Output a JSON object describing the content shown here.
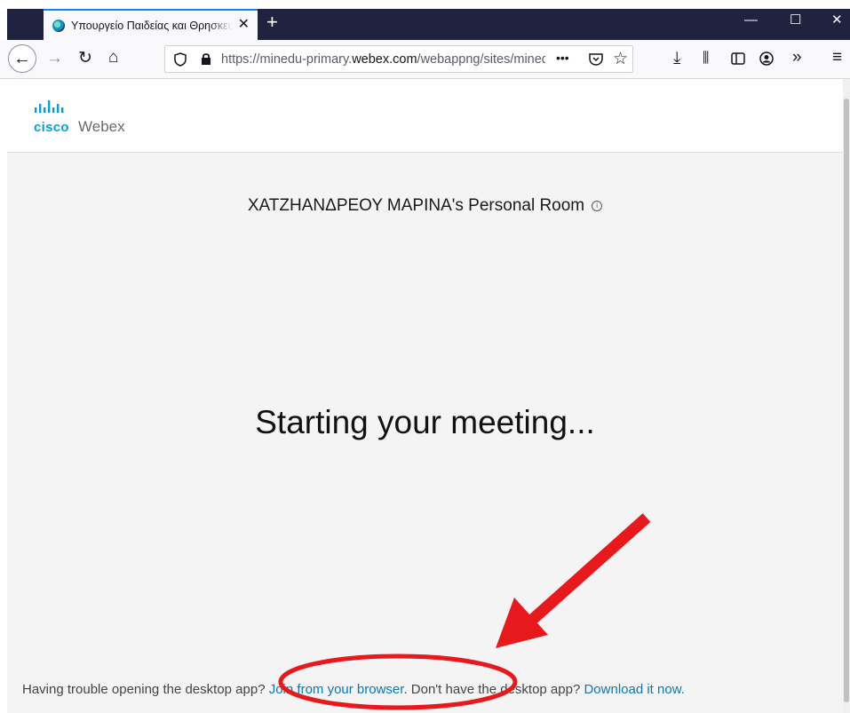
{
  "browser": {
    "tab_title": "Υπουργείο Παιδείας και Θρησκευμάτων",
    "tab_close": "✕",
    "new_tab": "+",
    "window_controls": {
      "minimize": "—",
      "maximize": "☐",
      "close": "✕"
    },
    "url_prefix": "https://minedu-primary.",
    "url_domain": "webex.com",
    "url_suffix": "/webappng/sites/minedu-primary",
    "url_more": "•••"
  },
  "page": {
    "logo_brand": "cisco",
    "logo_product": "Webex",
    "room_title": "ΧΑΤΖΗΑΝΔΡΕΟΥ ΜΑΡΙΝΑ's Personal Room",
    "status": "Starting your meeting...",
    "footer": {
      "prefix": "Having trouble opening the desktop app? ",
      "join_link": "Join from your browser",
      "middle": ". Don't have the desktop app? ",
      "download_link": "Download it now."
    }
  },
  "colors": {
    "annotation": "#e8191c",
    "link": "#0a78b4",
    "cisco_blue": "#049fd9",
    "tab_accent": "#0a84ff"
  },
  "icons": [
    "back-icon",
    "forward-icon",
    "reload-icon",
    "home-icon",
    "shield-icon",
    "lock-icon",
    "pocket-icon",
    "star-icon",
    "download-icon",
    "library-icon",
    "sidebar-icon",
    "account-icon",
    "overflow-icon",
    "menu-icon",
    "info-icon"
  ]
}
